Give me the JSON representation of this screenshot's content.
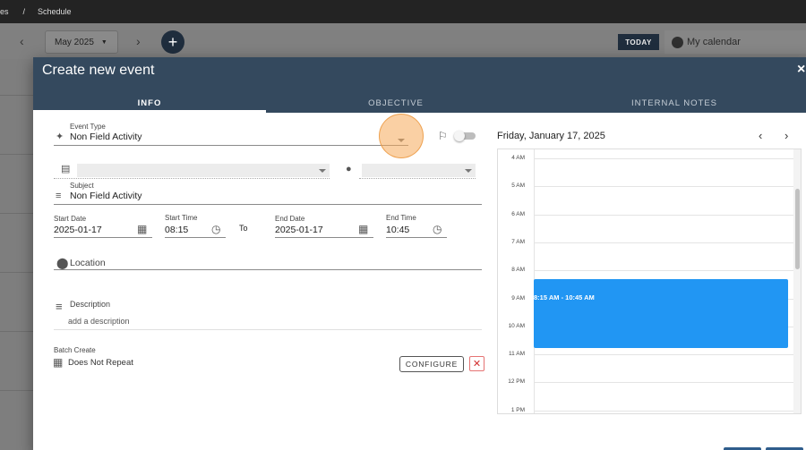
{
  "breadcrumb": {
    "parent": "es",
    "separator": "/",
    "current": "Schedule"
  },
  "calendar_toolbar": {
    "month": "May 2025",
    "today_label": "TODAY",
    "my_calendar": "My calendar"
  },
  "dialog": {
    "title": "Create new event",
    "close": "×",
    "tabs": [
      {
        "label": "INFO",
        "active": true
      },
      {
        "label": "OBJECTIVE",
        "active": false
      },
      {
        "label": "INTERNAL NOTES",
        "active": false
      }
    ]
  },
  "form": {
    "event_type_label": "Event Type",
    "event_type_value": "Non Field Activity",
    "subject_label": "Subject",
    "subject_value": "Non Field Activity",
    "start_date_label": "Start Date",
    "start_date_value": "2025-01-17",
    "start_time_label": "Start Time",
    "start_time_value": "08:15",
    "to_label": "To",
    "end_date_label": "End Date",
    "end_date_value": "2025-01-17",
    "end_time_label": "End Time",
    "end_time_value": "10:45",
    "location_placeholder": "Location",
    "description_label": "Description",
    "description_placeholder": "add a description",
    "batch_label": "Batch Create",
    "batch_value": "Does Not Repeat",
    "configure_label": "CONFIGURE",
    "remove_label": "✕"
  },
  "day_view": {
    "date": "Friday, January 17, 2025",
    "hours": [
      "4 AM",
      "5 AM",
      "6 AM",
      "7 AM",
      "8 AM",
      "9 AM",
      "10 AM",
      "11 AM",
      "12 PM",
      "1 PM"
    ],
    "event_text": "8:15 AM - 10:45 AM",
    "event_color": "#2196f3"
  },
  "colors": {
    "header": "#34495e",
    "accent": "#1f2d3d"
  }
}
